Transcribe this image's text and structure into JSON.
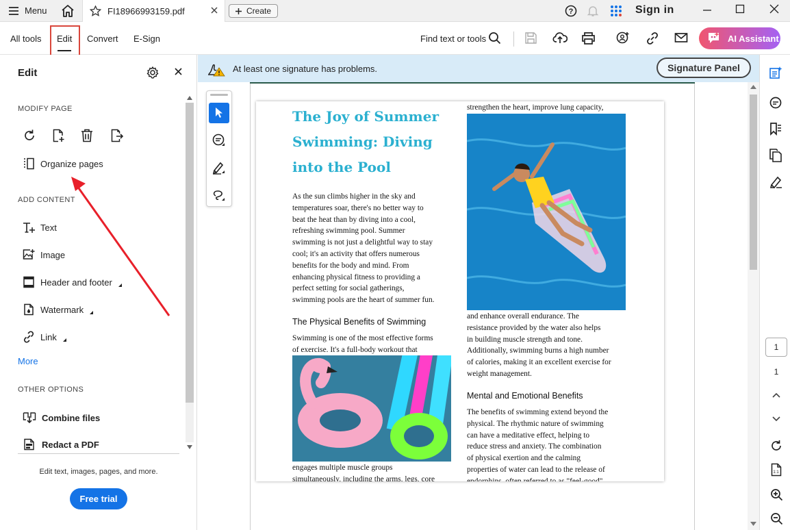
{
  "topbar": {
    "menu_label": "Menu",
    "tab_title": "FI18966993159.pdf",
    "create_label": "Create",
    "signin_label": "Sign in"
  },
  "toolbar": {
    "tabs": [
      "All tools",
      "Edit",
      "Convert",
      "E-Sign"
    ],
    "find_label": "Find text or tools",
    "ai_label": "AI Assistant",
    "ai_gradient": [
      "#f0566f",
      "#a461f4"
    ]
  },
  "left_panel": {
    "title": "Edit",
    "modify_page_label": "MODIFY PAGE",
    "organize_label": "Organize pages",
    "add_content_label": "ADD CONTENT",
    "add_items": [
      "Text",
      "Image",
      "Header and footer",
      "Watermark",
      "Link"
    ],
    "more_label": "More",
    "other_options_label": "OTHER OPTIONS",
    "combine_label": "Combine files",
    "redact_label": "Redact a PDF",
    "footer_desc": "Edit text, images, pages, and more.",
    "trial_label": "Free trial",
    "accent": "#1473e6"
  },
  "banner": {
    "message": "At least one signature has problems.",
    "button_label": "Signature Panel",
    "bg": "#d8ebf8"
  },
  "document": {
    "title": "The Joy of Summer Swimming: Diving into the Pool",
    "title_color": "#2bb0d0",
    "intro_lines": [
      "As the sun climbs higher in the sky and",
      "temperatures soar, there's no better way to",
      "beat the heat than by diving into a cool,",
      "refreshing swimming pool. Summer",
      "swimming is not just a delightful way to stay",
      "cool; it's an activity that offers numerous",
      "benefits for the body and mind. From",
      "enhancing physical fitness to providing a",
      "perfect setting for social gatherings,",
      "swimming pools are the heart of summer fun."
    ],
    "physical_heading": "The Physical Benefits of Swimming",
    "physical_lines": [
      "Swimming is one of the most effective forms",
      "of exercise. It's a full-body workout that"
    ],
    "col1_bottom_lines": [
      "engages multiple muscle groups",
      "simultaneously, including the arms, legs, core"
    ],
    "col2_top_line": "strengthen the heart, improve lung capacity,",
    "col2_mid_lines": [
      "and enhance overall endurance. The",
      "resistance provided by the water also helps",
      "in building muscle strength and tone.",
      "Additionally, swimming burns a high number",
      "of calories, making it an excellent exercise for",
      "weight management."
    ],
    "mental_heading": "Mental and Emotional Benefits",
    "mental_lines": [
      "The benefits of swimming extend beyond the",
      "physical. The rhythmic nature of swimming",
      "can have a meditative effect, helping to",
      "reduce stress and anxiety. The combination",
      "of physical exertion and the calming",
      "properties of water can lead to the release of",
      "endorphins, often referred to as \"feel-good\""
    ]
  },
  "pagination": {
    "current": "1",
    "total": "1"
  }
}
